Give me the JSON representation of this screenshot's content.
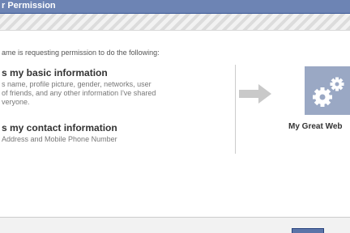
{
  "dialog": {
    "title": "r Permission"
  },
  "intro": {
    "text": "ame is requesting permission to do the following:"
  },
  "permissions": [
    {
      "title": "s my basic information",
      "description": "s name, profile picture, gender, networks, user\nof friends, and any other information I've shared\nveryone."
    },
    {
      "title": "s my contact information",
      "description": "Address and Mobile Phone Number"
    }
  ],
  "app": {
    "name": "My Great Web",
    "icon": "gear-icon"
  },
  "colors": {
    "titlebar": "#6d84b4",
    "titlebar_border": "#3b5998",
    "button": "#5b74a8",
    "app_icon_bg": "#9aa8c4"
  }
}
